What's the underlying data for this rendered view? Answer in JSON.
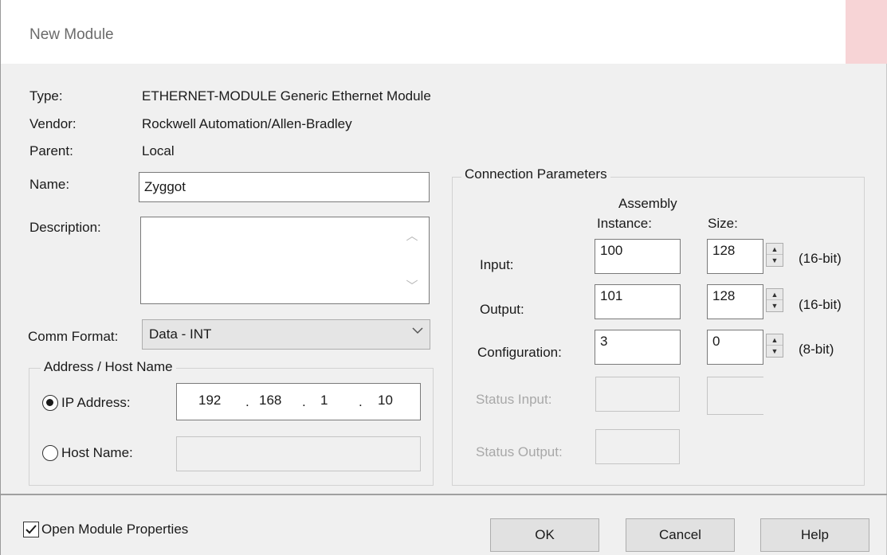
{
  "window": {
    "title": "New Module"
  },
  "info": {
    "type_label": "Type:",
    "type_value": "ETHERNET-MODULE Generic Ethernet Module",
    "vendor_label": "Vendor:",
    "vendor_value": "Rockwell Automation/Allen-Bradley",
    "parent_label": "Parent:",
    "parent_value": "Local"
  },
  "name": {
    "label": "Name:",
    "value": "Zyggot"
  },
  "description": {
    "label": "Description:",
    "value": ""
  },
  "comm_format": {
    "label": "Comm Format:",
    "value": "Data - INT"
  },
  "address": {
    "group_title": "Address / Host Name",
    "ip_label": "IP Address:",
    "ip_octets": [
      "192",
      "168",
      "1",
      "10"
    ],
    "ip_dot": ".",
    "host_label": "Host Name:",
    "host_value": "",
    "selected": "ip"
  },
  "connection": {
    "group_title": "Connection Parameters",
    "col_assembly_line1": "Assembly",
    "col_assembly_line2": "Instance:",
    "col_size": "Size:",
    "rows": [
      {
        "label": "Input:",
        "instance": "100",
        "size": "128",
        "unit": "(16-bit)",
        "enabled": true
      },
      {
        "label": "Output:",
        "instance": "101",
        "size": "128",
        "unit": "(16-bit)",
        "enabled": true
      },
      {
        "label": "Configuration:",
        "instance": "3",
        "size": "0",
        "unit": "(8-bit)",
        "enabled": true
      },
      {
        "label": "Status Input:",
        "instance": "",
        "size": "",
        "unit": "",
        "enabled": false
      },
      {
        "label": "Status Output:",
        "instance": "",
        "size": "",
        "unit": "",
        "enabled": false
      }
    ]
  },
  "footer": {
    "open_props_label": "Open Module Properties",
    "open_props_checked": true,
    "ok_label": "OK",
    "cancel_label": "Cancel",
    "help_label": "Help"
  },
  "colors": {
    "dialog_bg": "#f0f0f0",
    "title_bg": "#ffffff",
    "close_btn": "#f7d4d6",
    "disabled_text": "#a8a8a8"
  },
  "icons": [
    "close-icon",
    "chevron-down-icon",
    "scroll-up-icon",
    "scroll-down-icon",
    "spin-up-icon",
    "spin-down-icon",
    "checkmark-icon"
  ]
}
